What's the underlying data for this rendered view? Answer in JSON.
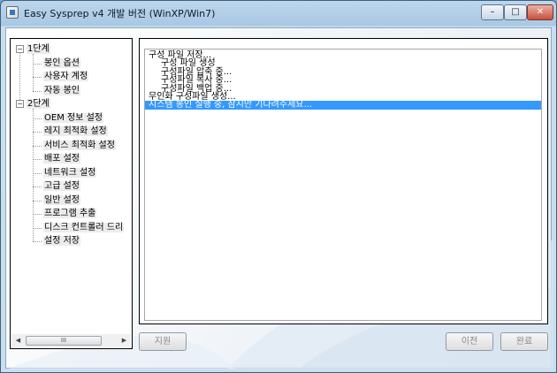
{
  "window": {
    "title": "Easy Sysprep v4 개발 버전 (WinXP/Win7)",
    "caption_min": "–",
    "caption_max": "□",
    "caption_close": "✕"
  },
  "tree": {
    "groups": [
      {
        "label": "1단계",
        "expander": "−",
        "items": [
          "봉인 옵션",
          "사용자 계정",
          "자동 봉인"
        ]
      },
      {
        "label": "2단계",
        "expander": "−",
        "items": [
          "OEM 정보 설정",
          "레지 최적화 설정",
          "서비스 최적화 설정",
          "배포 설정",
          "네트워크 설정",
          "고급 설정",
          "일반 설정",
          "프로그램 추출",
          "디스크 컨트롤러 드리",
          "설정 저장"
        ]
      }
    ],
    "scroll": {
      "left": "◀",
      "right": "▶",
      "thumb_grip": "III"
    }
  },
  "log": {
    "lines": [
      {
        "text": "구성 파일 저장...",
        "indent": 0
      },
      {
        "text": "구성 파일 생성",
        "indent": 1
      },
      {
        "text": "구성파일 압축 중...",
        "indent": 1
      },
      {
        "text": "구성파일 복사 중...",
        "indent": 1
      },
      {
        "text": "구성파일 백업 중...",
        "indent": 1
      },
      {
        "text": "무인화 구성파일 생성...",
        "indent": 0
      },
      {
        "text": "시스템 봉인 실행 중, 잠시만 기다려주세요...",
        "indent": 0,
        "selected": true
      }
    ]
  },
  "buttons": {
    "help": "지원",
    "prev": "이전",
    "finish": "완료"
  },
  "colors": {
    "selection": "#3399ff",
    "frame": "#a9c8e3"
  }
}
